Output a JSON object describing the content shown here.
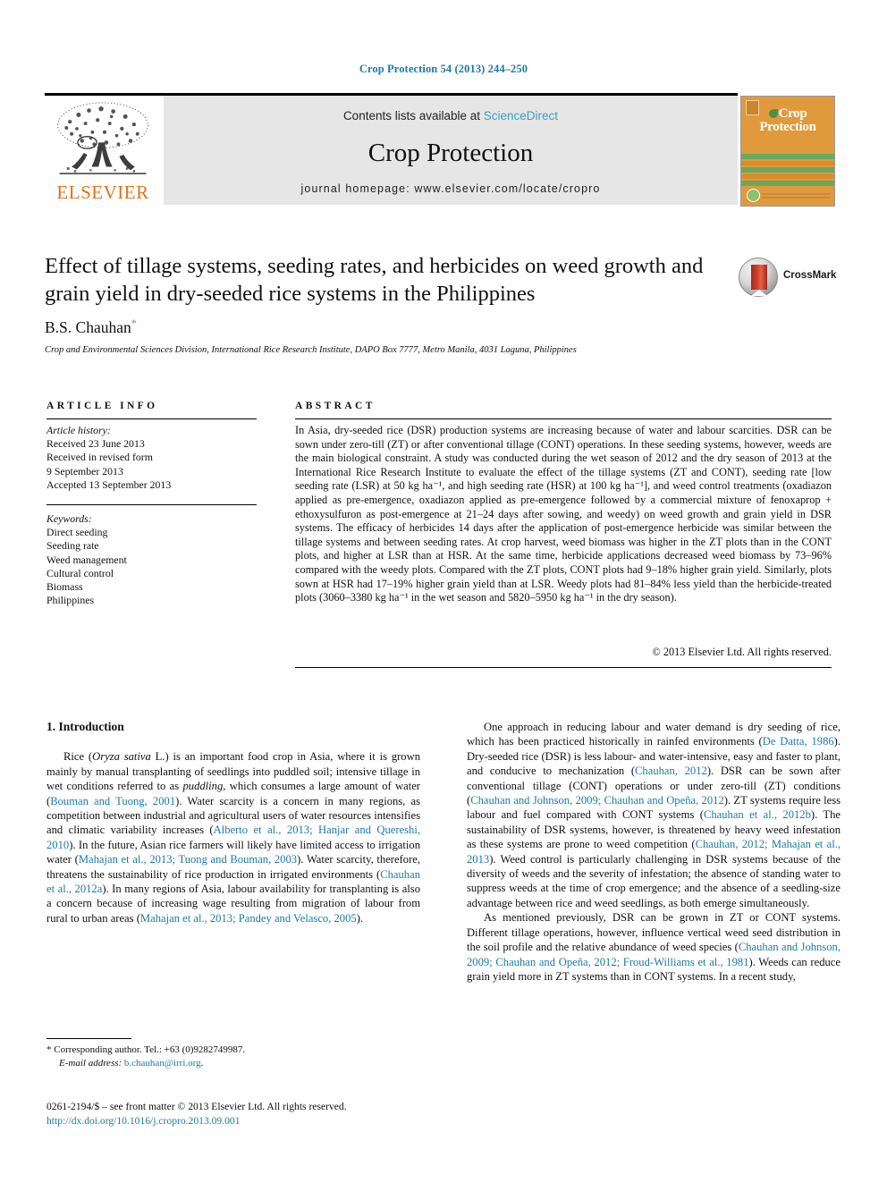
{
  "running_head": "Crop Protection 54 (2013) 244–250",
  "masthead": {
    "publisher_name": "ELSEVIER",
    "contents_prefix": "Contents lists available at ",
    "contents_link": "ScienceDirect",
    "journal_name": "Crop Protection",
    "homepage": "journal homepage: www.elsevier.com/locate/cropro",
    "cover_title_line1": "Crop",
    "cover_title_line2": "Protection"
  },
  "article": {
    "title": "Effect of tillage systems, seeding rates, and herbicides on weed growth and grain yield in dry-seeded rice systems in the Philippines",
    "author": "B.S. Chauhan",
    "author_mark": "*",
    "affiliation": "Crop and Environmental Sciences Division, International Rice Research Institute, DAPO Box 7777, Metro Manila, 4031 Laguna, Philippines",
    "crossmark_label": "CrossMark"
  },
  "article_info": {
    "heading": "ARTICLE INFO",
    "history_label": "Article history:",
    "history": [
      "Received 23 June 2013",
      "Received in revised form",
      "9 September 2013",
      "Accepted 13 September 2013"
    ],
    "keywords_label": "Keywords:",
    "keywords": [
      "Direct seeding",
      "Seeding rate",
      "Weed management",
      "Cultural control",
      "Biomass",
      "Philippines"
    ]
  },
  "abstract": {
    "heading": "ABSTRACT",
    "text": "In Asia, dry-seeded rice (DSR) production systems are increasing because of water and labour scarcities. DSR can be sown under zero-till (ZT) or after conventional tillage (CONT) operations. In these seeding systems, however, weeds are the main biological constraint. A study was conducted during the wet season of 2012 and the dry season of 2013 at the International Rice Research Institute to evaluate the effect of the tillage systems (ZT and CONT), seeding rate [low seeding rate (LSR) at 50 kg ha⁻¹, and high seeding rate (HSR) at 100 kg ha⁻¹], and weed control treatments (oxadiazon applied as pre-emergence, oxadiazon applied as pre-emergence followed by a commercial mixture of fenoxaprop + ethoxysulfuron as post-emergence at 21–24 days after sowing, and weedy) on weed growth and grain yield in DSR systems. The efficacy of herbicides 14 days after the application of post-emergence herbicide was similar between the tillage systems and between seeding rates. At crop harvest, weed biomass was higher in the ZT plots than in the CONT plots, and higher at LSR than at HSR. At the same time, herbicide applications decreased weed biomass by 73–96% compared with the weedy plots. Compared with the ZT plots, CONT plots had 9–18% higher grain yield. Similarly, plots sown at HSR had 17–19% higher grain yield than at LSR. Weedy plots had 81–84% less yield than the herbicide-treated plots (3060–3380 kg ha⁻¹ in the wet season and 5820–5950 kg ha⁻¹ in the dry season).",
    "copyright": "© 2013 Elsevier Ltd. All rights reserved."
  },
  "introduction": {
    "heading": "1. Introduction",
    "left_paragraphs": [
      "Rice (Oryza sativa L.) is an important food crop in Asia, where it is grown mainly by manual transplanting of seedlings into puddled soil; intensive tillage in wet conditions referred to as puddling, which consumes a large amount of water (Bouman and Tuong, 2001). Water scarcity is a concern in many regions, as competition between industrial and agricultural users of water resources intensifies and climatic variability increases (Alberto et al., 2013; Hanjar and Quereshi, 2010). In the future, Asian rice farmers will likely have limited access to irrigation water (Mahajan et al., 2013; Tuong and Bouman, 2003). Water scarcity, therefore, threatens the sustainability of rice production in irrigated environments (Chauhan et al., 2012a). In many regions of Asia, labour availability for transplanting is also a concern because of increasing wage resulting from migration of labour from rural to urban areas (Mahajan et al., 2013; Pandey and Velasco, 2005)."
    ],
    "right_paragraphs": [
      "One approach in reducing labour and water demand is dry seeding of rice, which has been practiced historically in rainfed environments (De Datta, 1986). Dry-seeded rice (DSR) is less labour- and water-intensive, easy and faster to plant, and conducive to mechanization (Chauhan, 2012). DSR can be sown after conventional tillage (CONT) operations or under zero-till (ZT) conditions (Chauhan and Johnson, 2009; Chauhan and Opeña, 2012). ZT systems require less labour and fuel compared with CONT systems (Chauhan et al., 2012b). The sustainability of DSR systems, however, is threatened by heavy weed infestation as these systems are prone to weed competition (Chauhan, 2012; Mahajan et al., 2013). Weed control is particularly challenging in DSR systems because of the diversity of weeds and the severity of infestation; the absence of standing water to suppress weeds at the time of crop emergence; and the absence of a seedling-size advantage between rice and weed seedlings, as both emerge simultaneously.",
      "As mentioned previously, DSR can be grown in ZT or CONT systems. Different tillage operations, however, influence vertical weed seed distribution in the soil profile and the relative abundance of weed species (Chauhan and Johnson, 2009; Chauhan and Opeña, 2012; Froud-Williams et al., 1981). Weeds can reduce grain yield more in ZT systems than in CONT systems. In a recent study,"
    ]
  },
  "footnotes": {
    "corresponding_mark": "*",
    "corresponding": "Corresponding author. Tel.: +63 (0)9282749987.",
    "email_label": "E-mail address:",
    "email": "b.chauhan@irri.org",
    "email_trailing": ".",
    "imprint": "0261-2194/$ – see front matter © 2013 Elsevier Ltd. All rights reserved.",
    "doi": "http://dx.doi.org/10.1016/j.cropro.2013.09.001"
  },
  "colors": {
    "link_blue": "#1a7aa8",
    "sciencedirect_blue": "#3a9fc4",
    "elsevier_orange": "#e8701a",
    "cover_orange": "#e09a3c",
    "cover_green": "#6aa85e"
  }
}
